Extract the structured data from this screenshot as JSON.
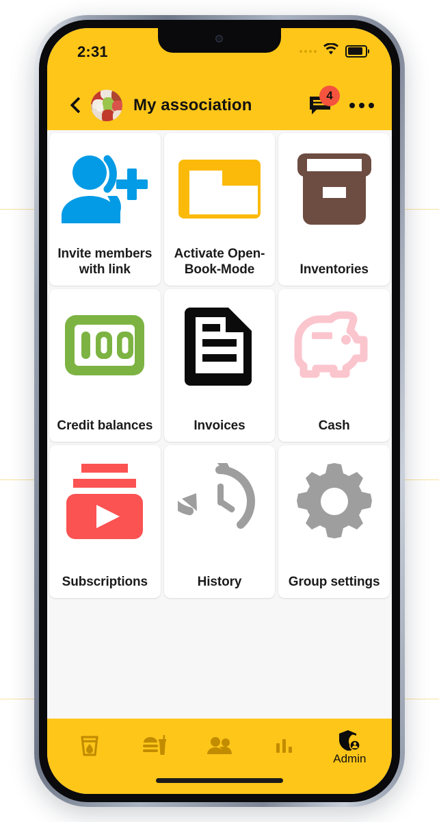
{
  "theme": {
    "accent_yellow": "#FFC61A",
    "badge_red": "#F4533E",
    "screen_bg": "#F7F7F7",
    "card_bg": "#FFFFFF"
  },
  "status_bar": {
    "time": "2:31",
    "cellular_icon": "signal-dots-icon",
    "wifi_icon": "wifi-icon",
    "battery_icon": "battery-icon"
  },
  "app_bar": {
    "back_icon": "chevron-left-icon",
    "avatar": "group-avatar",
    "title": "My association",
    "chat_icon": "chat-bubble-icon",
    "chat_badge_count": "4",
    "overflow_icon": "more-horizontal-icon"
  },
  "grid": {
    "items": [
      {
        "label": "Invite members with link",
        "icon": "person-add-icon",
        "color": "#039BE5"
      },
      {
        "label": "Activate Open-Book-Mode",
        "icon": "folder-outline-icon",
        "color": "#FBBA0A"
      },
      {
        "label": "Inventories",
        "icon": "archive-box-icon",
        "color": "#6D4C41"
      },
      {
        "label": "Credit balances",
        "icon": "banknote-100-icon",
        "color": "#7CB342"
      },
      {
        "label": "Invoices",
        "icon": "document-lines-icon",
        "color": "#0B0B0B"
      },
      {
        "label": "Cash",
        "icon": "piggy-bank-icon",
        "color": "#FBC5CE"
      },
      {
        "label": "Subscriptions",
        "icon": "subscriptions-play-icon",
        "color": "#FB5252"
      },
      {
        "label": "History",
        "icon": "history-clock-icon",
        "color": "#9E9E9E"
      },
      {
        "label": "Group settings",
        "icon": "gear-icon",
        "color": "#9E9E9E"
      }
    ]
  },
  "tab_bar": {
    "tabs": [
      {
        "label": "",
        "icon": "drink-cup-icon",
        "active": false
      },
      {
        "label": "",
        "icon": "food-meal-icon",
        "active": false
      },
      {
        "label": "",
        "icon": "people-icon",
        "active": false
      },
      {
        "label": "",
        "icon": "bar-chart-icon",
        "active": false
      },
      {
        "label": "Admin",
        "icon": "shield-person-icon",
        "active": true
      }
    ]
  }
}
